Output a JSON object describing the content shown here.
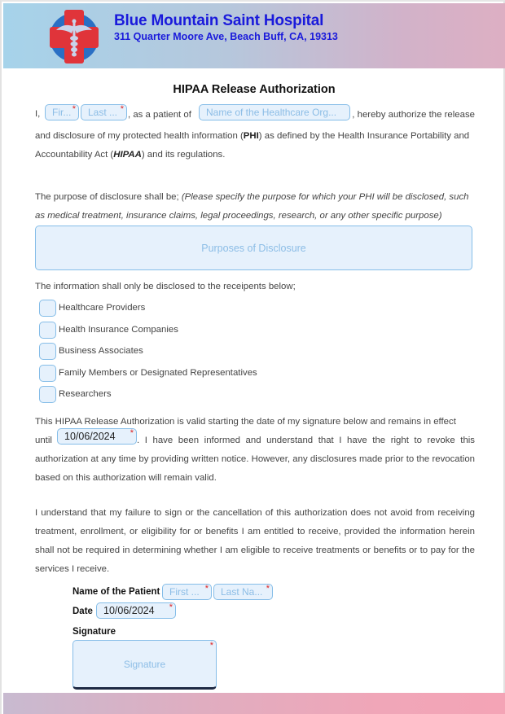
{
  "header": {
    "logo_icon": "medical-cross-caduceus-icon",
    "hospital_name": "Blue Mountain Saint Hospital",
    "address": "311 Quarter Moore Ave, Beach Buff, CA, 19313"
  },
  "title": "HIPAA Release Authorization",
  "intro": {
    "prefix": "I,",
    "first_name_placeholder": "Fir...",
    "last_name_placeholder": "Last ...",
    "mid": ", as a patient of",
    "org_placeholder": "Name of the Healthcare Org...",
    "suffix": ", hereby authorize the release",
    "line2_a": "and disclosure of my protected health information (",
    "phi": "PHI",
    "line2_b": ") as defined by the Health Insurance Portability and",
    "line3_a": "Accountability Act (",
    "hipaa": "HIPAA",
    "line3_b": ") and its regulations."
  },
  "purpose": {
    "lead": "The purpose of disclosure shall be;",
    "hint": "(Please specify the purpose for which your PHI will be disclosed, such as medical treatment, insurance claims, legal proceedings, research, or any other specific purpose)",
    "placeholder": "Purposes of Disclosure"
  },
  "recipients": {
    "lead": "The information shall only be disclosed to the receipents below;",
    "options": [
      {
        "label": "Healthcare Providers",
        "checked": false
      },
      {
        "label": "Health Insurance Companies",
        "checked": false
      },
      {
        "label": "Business Associates",
        "checked": false
      },
      {
        "label": "Family Members or Designated Representatives",
        "checked": false
      },
      {
        "label": "Researchers",
        "checked": false
      }
    ]
  },
  "validity": {
    "line1": "This HIPAA Release Authorization is valid starting the date of my signature below and remains in effect",
    "until": "until",
    "date_value": "10/06/2024",
    "rest": ". I have been informed and understand that I have the right to revoke this authorization at any time by providing written notice. However, any disclosures made prior to the revocation based on this authorization will remain valid."
  },
  "understanding": "I understand that my failure to sign or the cancellation of this authorization does not avoid from receiving treatment, enrollment, or eligibility for or benefits I am entitled to receive, provided the information herein shall not be required in determining whether I am eligible to receive treatments or benefits or to pay for the services I receive.",
  "signoff": {
    "patient_label": "Name of the Patient",
    "first_placeholder": "First ...",
    "last_placeholder": "Last Na...",
    "date_label": "Date",
    "date_value": "10/06/2024",
    "signature_label": "Signature",
    "signature_placeholder": "Signature"
  },
  "required_mark": "*"
}
